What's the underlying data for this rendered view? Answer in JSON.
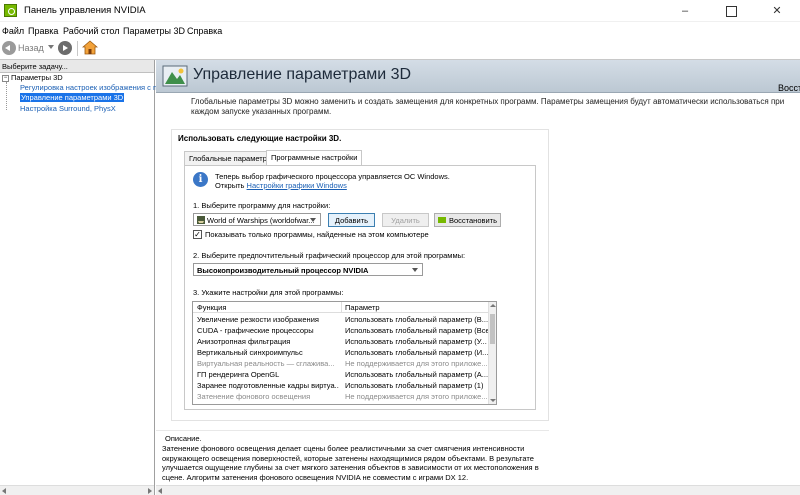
{
  "window": {
    "title": "Панель управления NVIDIA",
    "minimize": "–",
    "close": "✕"
  },
  "menu": [
    "Файл",
    "Правка",
    "Рабочий стол",
    "Параметры 3D",
    "Справка"
  ],
  "toolbar": {
    "back_label": "Назад",
    "back_icon": "back-arrow-icon",
    "forward_icon": "forward-arrow-icon",
    "home_icon": "home-icon"
  },
  "left": {
    "header": "Выберите задачу...",
    "root": {
      "expander": "−",
      "label": "Параметры 3D"
    },
    "items": [
      {
        "label": "Регулировка настроек изображения с п"
      },
      {
        "label": "Управление параметрами 3D"
      },
      {
        "label": "Настройка Surround, PhysX"
      }
    ]
  },
  "main": {
    "title": "Управление параметрами 3D",
    "restore": "Восстан",
    "intro": "Глобальные параметры 3D можно заменить и создать замещения для конкретных программ. Параметры замещения будут автоматически использоваться при каждом запуске указанных программ.",
    "frame_title": "Использовать следующие настройки 3D.",
    "tabs": [
      "Глобальные параметры",
      "Программные настройки"
    ],
    "info": {
      "line1": "Теперь выбор графического процессора управляется ОС Windows.",
      "line2_prefix": "Открыть ",
      "link": "Настройки графики Windows"
    },
    "step1": "1. Выберите программу для настройки:",
    "program": "World of Warships (worldofwar...",
    "buttons": {
      "add": "Добавить",
      "remove": "Удалить",
      "restore": "Восстановить"
    },
    "checkbox": {
      "checked": true,
      "mark": "✓",
      "label": "Показывать только программы, найденные на этом компьютере"
    },
    "step2": "2. Выберите предпочтительный графический процессор для этой программы:",
    "gpu": "Высокопроизводительный процессор NVIDIA",
    "step3": "3. Укажите настройки для этой программы:",
    "grid": {
      "headers": [
        "Функция",
        "Параметр"
      ],
      "rows": [
        {
          "f": "Увеличение резкости изображения",
          "p": "Использовать глобальный параметр (В..."
        },
        {
          "f": "CUDA - графические процессоры",
          "p": "Использовать глобальный параметр (Все)"
        },
        {
          "f": "Анизотропная фильтрация",
          "p": "Использовать глобальный параметр (У..."
        },
        {
          "f": "Вертикальный синхроимпульс",
          "p": "Использовать глобальный параметр (И..."
        },
        {
          "f": "Виртуальная реальность — сглажива...",
          "p": "Не поддерживается для этого приложе..."
        },
        {
          "f": "ГП рендеринга OpenGL",
          "p": "Использовать глобальный параметр (А..."
        },
        {
          "f": "Заранее подготовленные кадры виртуа...",
          "p": "Использовать глобальный параметр (1)"
        },
        {
          "f": "Затенение фонового освещения",
          "p": "Не поддерживается для этого приложе..."
        }
      ]
    },
    "desc_title": "Описание.",
    "desc": "Затенение фонового освещения делает сцены более реалистичными за счет смягчения интенсивности окружающего освещения поверхностей, которые затенены находящимися рядом объектами. В результате улучшается ощущение глубины за счет мягкого затенения объектов в зависимости от их местоположения в сцене. Алгоритм затенения фонового освещения NVIDIA не совместим с играми DX 12."
  },
  "colors": {
    "accent": "#1a73e8",
    "link": "#1a5fb4",
    "nvidia": "#76b900"
  }
}
